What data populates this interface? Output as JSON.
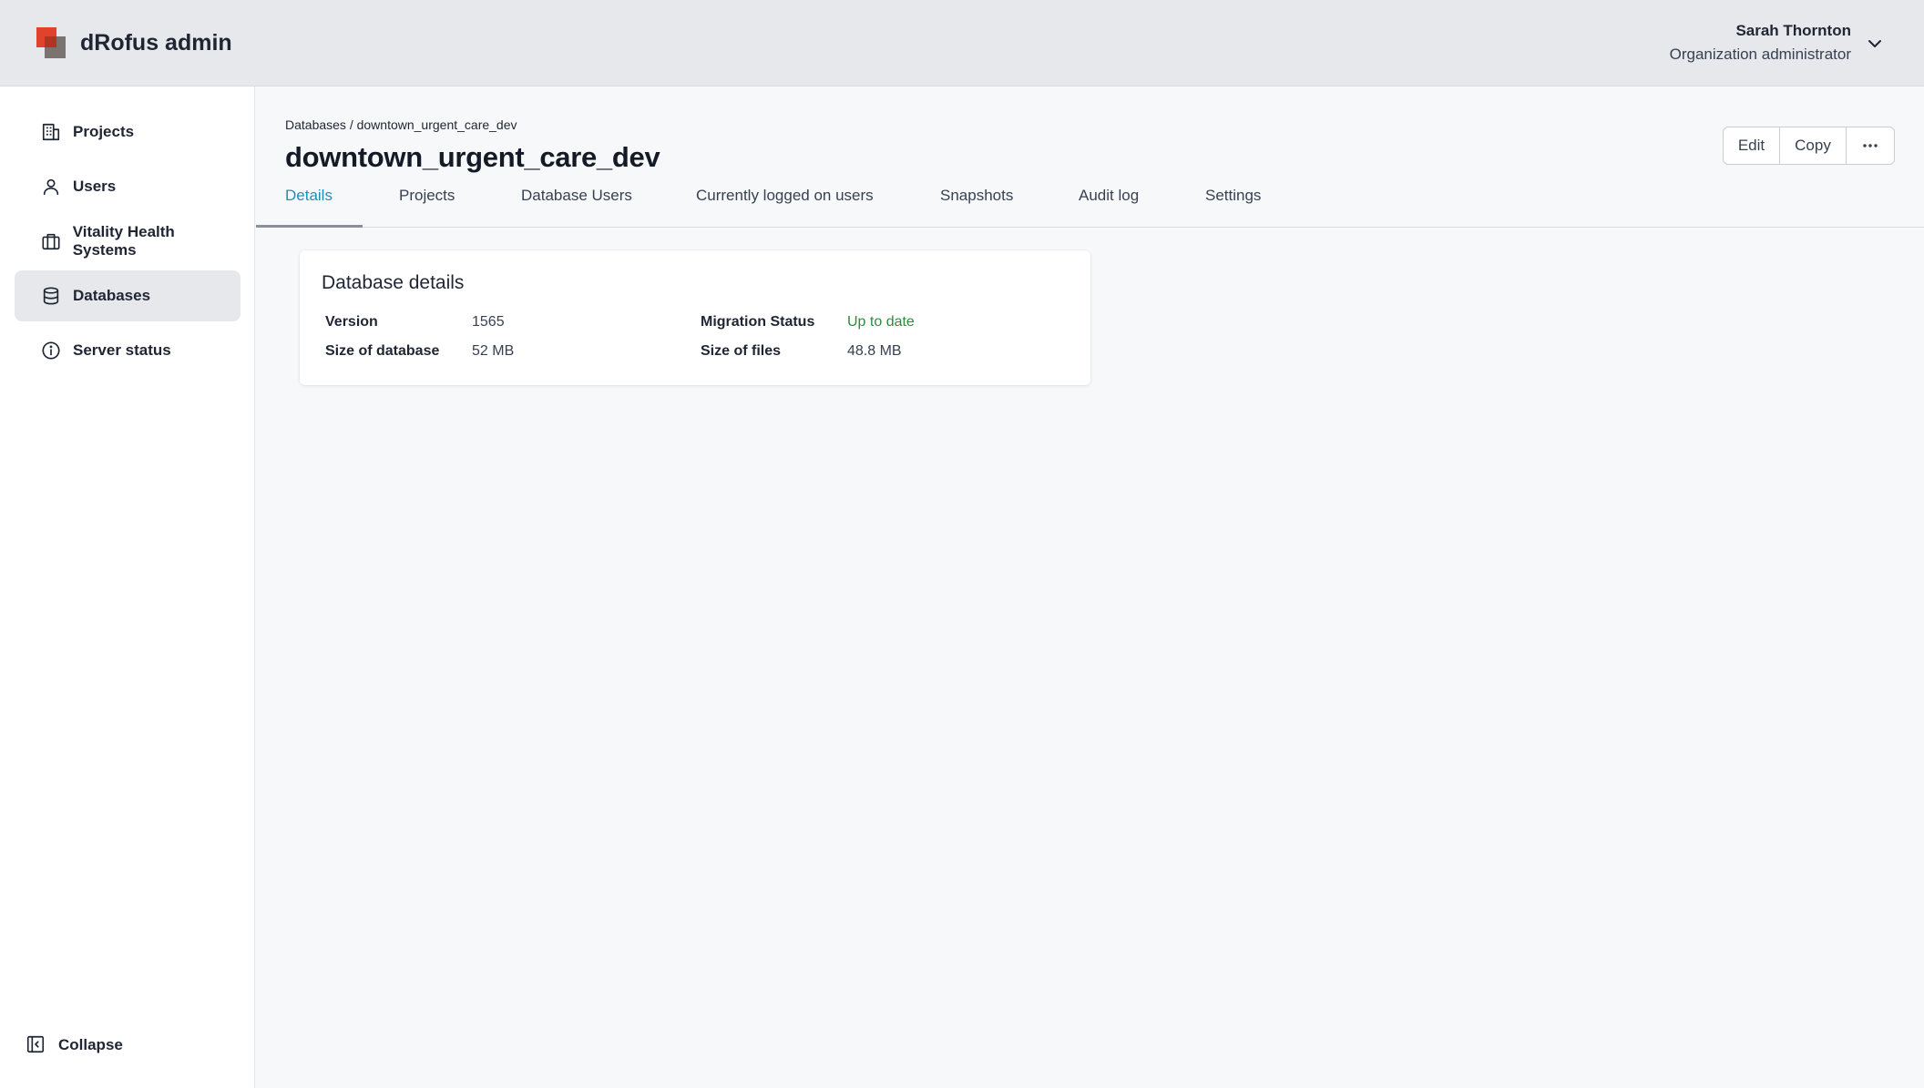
{
  "app": {
    "title": "dRofus admin"
  },
  "user": {
    "name": "Sarah Thornton",
    "role": "Organization administrator"
  },
  "sidebar": {
    "items": [
      {
        "label": "Projects",
        "icon": "building-icon"
      },
      {
        "label": "Users",
        "icon": "user-icon"
      },
      {
        "label": "Vitality Health Systems",
        "icon": "briefcase-icon"
      },
      {
        "label": "Databases",
        "icon": "database-icon",
        "active": true
      },
      {
        "label": "Server status",
        "icon": "info-icon"
      }
    ],
    "collapse_label": "Collapse"
  },
  "breadcrumb": "Databases / downtown_urgent_care_dev",
  "page": {
    "title": "downtown_urgent_care_dev"
  },
  "actions": {
    "edit": "Edit",
    "copy": "Copy",
    "more": "···"
  },
  "tabs": [
    {
      "label": "Details",
      "active": true
    },
    {
      "label": "Projects"
    },
    {
      "label": "Database Users"
    },
    {
      "label": "Currently logged on users"
    },
    {
      "label": "Snapshots"
    },
    {
      "label": "Audit log"
    },
    {
      "label": "Settings"
    }
  ],
  "details": {
    "title": "Database details",
    "version_label": "Version",
    "version_value": "1565",
    "size_db_label": "Size of database",
    "size_db_value": "52 MB",
    "migration_label": "Migration Status",
    "migration_value": "Up to date",
    "size_files_label": "Size of files",
    "size_files_value": "48.8 MB"
  },
  "colors": {
    "accent": "#1e8fb8",
    "success": "#2e8b3e",
    "brand": "#e0422c"
  }
}
